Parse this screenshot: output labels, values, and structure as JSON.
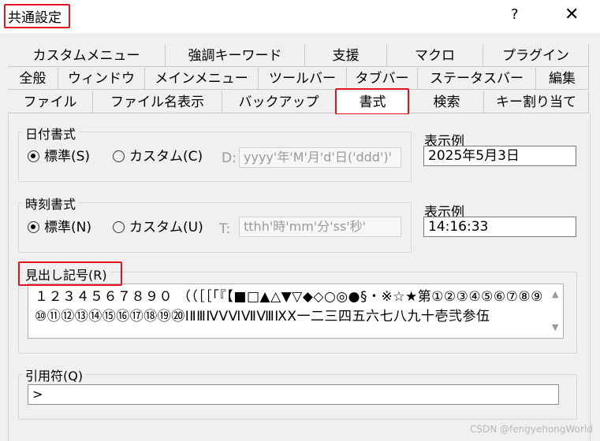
{
  "window": {
    "title": "共通設定",
    "help_label": "?",
    "close_label": "✕"
  },
  "tabs": {
    "row1": [
      "カスタムメニュー",
      "強調キーワード",
      "支援",
      "マクロ",
      "プラグイン"
    ],
    "row2": [
      "全般",
      "ウィンドウ",
      "メインメニュー",
      "ツールバー",
      "タブバー",
      "ステータスバー",
      "編集"
    ],
    "row3": [
      "ファイル",
      "ファイル名表示",
      "バックアップ",
      "書式",
      "検索",
      "キー割り当て"
    ],
    "active": "書式"
  },
  "date_format": {
    "group_label": "日付書式",
    "standard_label": "標準(S)",
    "custom_label": "カスタム(C)",
    "selected": "standard",
    "prefix": "D:",
    "custom_value": "yyyy'年'M'月'd'日('ddd')'",
    "sample_label": "表示例",
    "sample_value": "2025年5月3日"
  },
  "time_format": {
    "group_label": "時刻書式",
    "standard_label": "標準(N)",
    "custom_label": "カスタム(U)",
    "selected": "standard",
    "prefix": "T:",
    "custom_value": "tthh'時'mm'分'ss'秒'",
    "sample_label": "表示例",
    "sample_value": "14:16:33"
  },
  "heading_symbols": {
    "group_label": "見出し記号(R)",
    "value": "１２３４５６７８９０ （（［［「『【■□▲△▼▽◆◇○◎●§・※☆★第①②③④⑤⑥⑦⑧⑨⑩⑪⑫⑬⑭⑮⑯⑰⑱⑲⑳ⅠⅡⅢⅣⅤⅥⅦⅧⅨⅩ一二三四五六七八九十壱弐参伍"
  },
  "quote": {
    "group_label": "引用符(Q)",
    "value": ">"
  },
  "watermark": "CSDN @fengyehongWorld"
}
